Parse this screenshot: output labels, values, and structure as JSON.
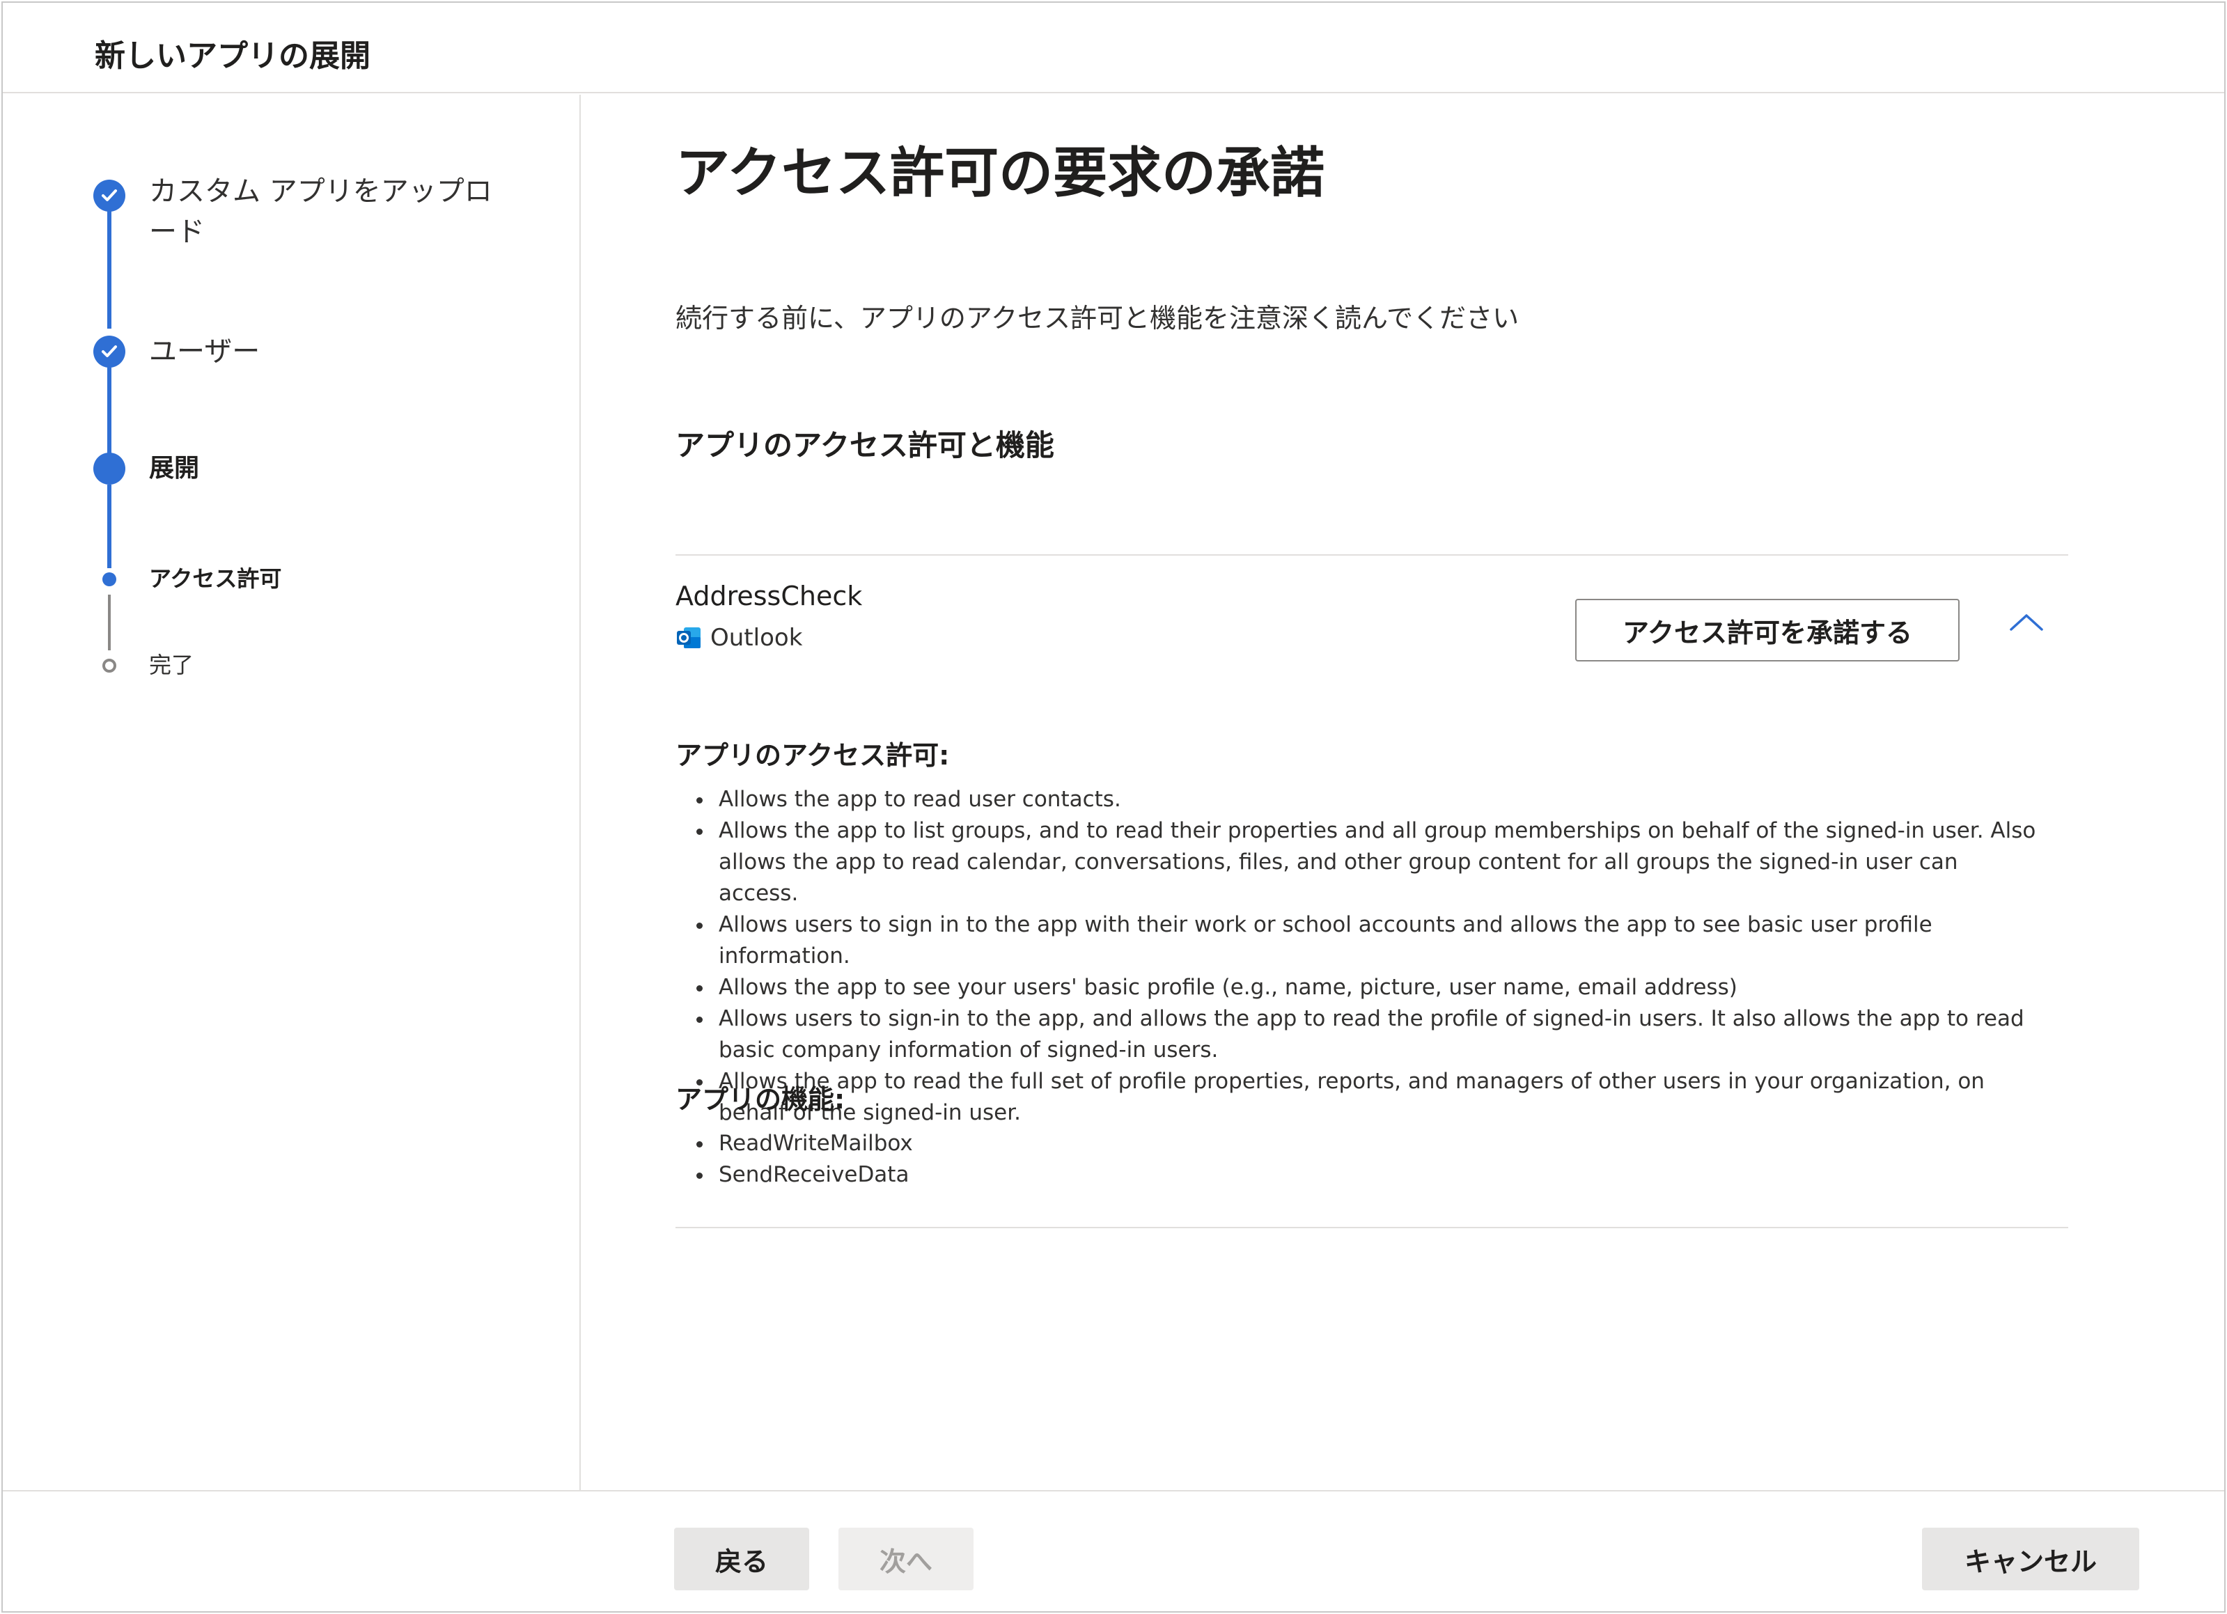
{
  "header": {
    "title": "新しいアプリの展開"
  },
  "steps": [
    {
      "label": "カスタム アプリをアップロ",
      "label_line2": "ード",
      "state": "done"
    },
    {
      "label": "ユーザー",
      "state": "done"
    },
    {
      "label": "展開",
      "state": "current"
    },
    {
      "label": "アクセス許可",
      "state": "current-sub"
    },
    {
      "label": "完了",
      "state": "todo"
    }
  ],
  "main": {
    "title": "アクセス許可の要求の承諾",
    "intro": "続行する前に、アプリのアクセス許可と機能を注意深く読んでください",
    "section_title": "アプリのアクセス許可と機能",
    "app": {
      "name": "AddressCheck",
      "host": "Outlook",
      "host_icon": "outlook-icon",
      "accept_label": "アクセス許可を承諾する",
      "expand_icon": "chevron-up-icon"
    },
    "permissions_title": "アプリのアクセス許可:",
    "permissions": [
      "Allows the app to read user contacts.",
      "Allows the app to list groups, and to read their properties and all group memberships on behalf of the signed-in user. Also allows the app to read calendar, conversations, files, and other group content for all groups the signed-in user can access.",
      "Allows users to sign in to the app with their work or school accounts and allows the app to see basic user profile information.",
      "Allows the app to see your users' basic profile (e.g., name, picture, user name, email address)",
      "Allows users to sign-in to the app, and allows the app to read the profile of signed-in users. It also allows the app to read basic company information of signed-in users.",
      "Allows the app to read the full set of profile properties, reports, and managers of other users in your organization, on behalf of the signed-in user."
    ],
    "capabilities_title": "アプリの機能:",
    "capabilities": [
      "ReadWriteMailbox",
      "SendReceiveData"
    ]
  },
  "footer": {
    "back_label": "戻る",
    "next_label": "次へ",
    "cancel_label": "キャンセル"
  },
  "colors": {
    "accent": "#2f6fd4",
    "border": "#e1dfdd",
    "button_bg": "#e7e6e5"
  }
}
